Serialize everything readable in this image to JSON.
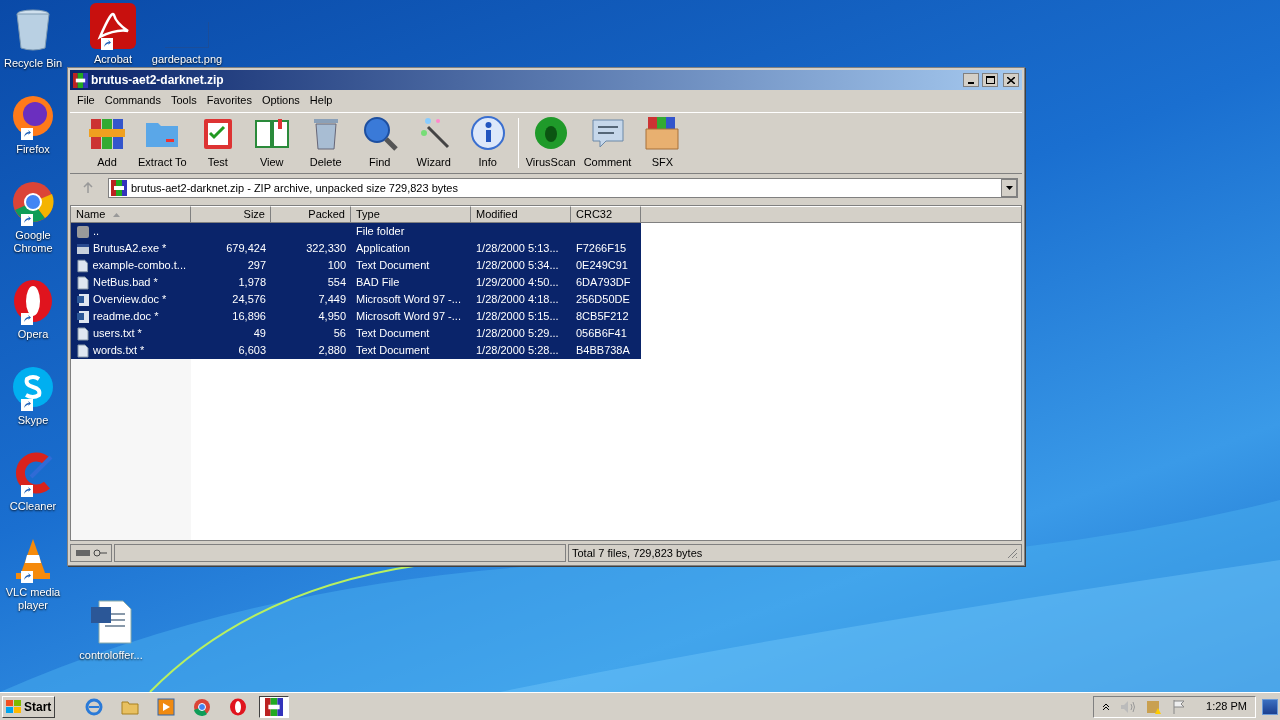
{
  "desktop_icons": [
    {
      "label": "Recycle Bin",
      "kind": "bin"
    },
    {
      "label": "Firefox",
      "kind": "firefox"
    },
    {
      "label": "Google Chrome",
      "kind": "chrome"
    },
    {
      "label": "Opera",
      "kind": "opera"
    },
    {
      "label": "Skype",
      "kind": "skype"
    },
    {
      "label": "CCleaner",
      "kind": "ccleaner"
    },
    {
      "label": "VLC media player",
      "kind": "vlc"
    }
  ],
  "desktop_icons_top": [
    {
      "label": "Acrobat",
      "kind": "acrobat"
    },
    {
      "label": "gardepact.png",
      "kind": "blank"
    }
  ],
  "desktop_icon_bottom": {
    "label": "controloffer...",
    "kind": "word"
  },
  "window": {
    "title": "brutus-aet2-darknet.zip",
    "menu": [
      "File",
      "Commands",
      "Tools",
      "Favorites",
      "Options",
      "Help"
    ],
    "toolbar": [
      {
        "label": "Add",
        "kind": "add"
      },
      {
        "label": "Extract To",
        "kind": "extract"
      },
      {
        "label": "Test",
        "kind": "test"
      },
      {
        "label": "View",
        "kind": "view"
      },
      {
        "label": "Delete",
        "kind": "delete"
      },
      {
        "label": "Find",
        "kind": "find"
      },
      {
        "label": "Wizard",
        "kind": "wizard"
      },
      {
        "label": "Info",
        "kind": "info"
      },
      {
        "label": "VirusScan",
        "kind": "virus"
      },
      {
        "label": "Comment",
        "kind": "comment"
      },
      {
        "label": "SFX",
        "kind": "sfx"
      }
    ],
    "address": "brutus-aet2-darknet.zip - ZIP archive, unpacked size 729,823 bytes",
    "columns": [
      "Name",
      "Size",
      "Packed",
      "Type",
      "Modified",
      "CRC32"
    ],
    "rows": [
      {
        "kind": "folder",
        "selected": true,
        "cells": [
          "..",
          "",
          "",
          "File folder",
          "",
          ""
        ]
      },
      {
        "kind": "exe",
        "selected": true,
        "cells": [
          "BrutusA2.exe *",
          "679,424",
          "322,330",
          "Application",
          "1/28/2000 5:13...",
          "F7266F15"
        ]
      },
      {
        "kind": "file",
        "selected": true,
        "cells": [
          "example-combo.t...",
          "297",
          "100",
          "Text Document",
          "1/28/2000 5:34...",
          "0E249C91"
        ]
      },
      {
        "kind": "file",
        "selected": true,
        "cells": [
          "NetBus.bad *",
          "1,978",
          "554",
          "BAD File",
          "1/29/2000 4:50...",
          "6DA793DF"
        ]
      },
      {
        "kind": "doc",
        "selected": true,
        "cells": [
          "Overview.doc *",
          "24,576",
          "7,449",
          "Microsoft Word 97 -...",
          "1/28/2000 4:18...",
          "256D50DE"
        ]
      },
      {
        "kind": "doc",
        "selected": true,
        "cells": [
          "readme.doc *",
          "16,896",
          "4,950",
          "Microsoft Word 97 -...",
          "1/28/2000 5:15...",
          "8CB5F212"
        ]
      },
      {
        "kind": "file",
        "selected": true,
        "cells": [
          "users.txt *",
          "49",
          "56",
          "Text Document",
          "1/28/2000 5:29...",
          "056B6F41"
        ]
      },
      {
        "kind": "file",
        "selected": true,
        "cells": [
          "words.txt *",
          "6,603",
          "2,880",
          "Text Document",
          "1/28/2000 5:28...",
          "B4BB738A"
        ]
      }
    ],
    "status": "Total 7 files, 729,823 bytes"
  },
  "taskbar": {
    "start": "Start",
    "apps": [
      {
        "kind": "ie",
        "selected": false
      },
      {
        "kind": "explorer",
        "selected": false
      },
      {
        "kind": "media",
        "selected": false
      },
      {
        "kind": "chrome",
        "selected": false
      },
      {
        "kind": "opera",
        "selected": false
      },
      {
        "kind": "winrar",
        "selected": true
      }
    ],
    "clock": "1:28 PM"
  }
}
